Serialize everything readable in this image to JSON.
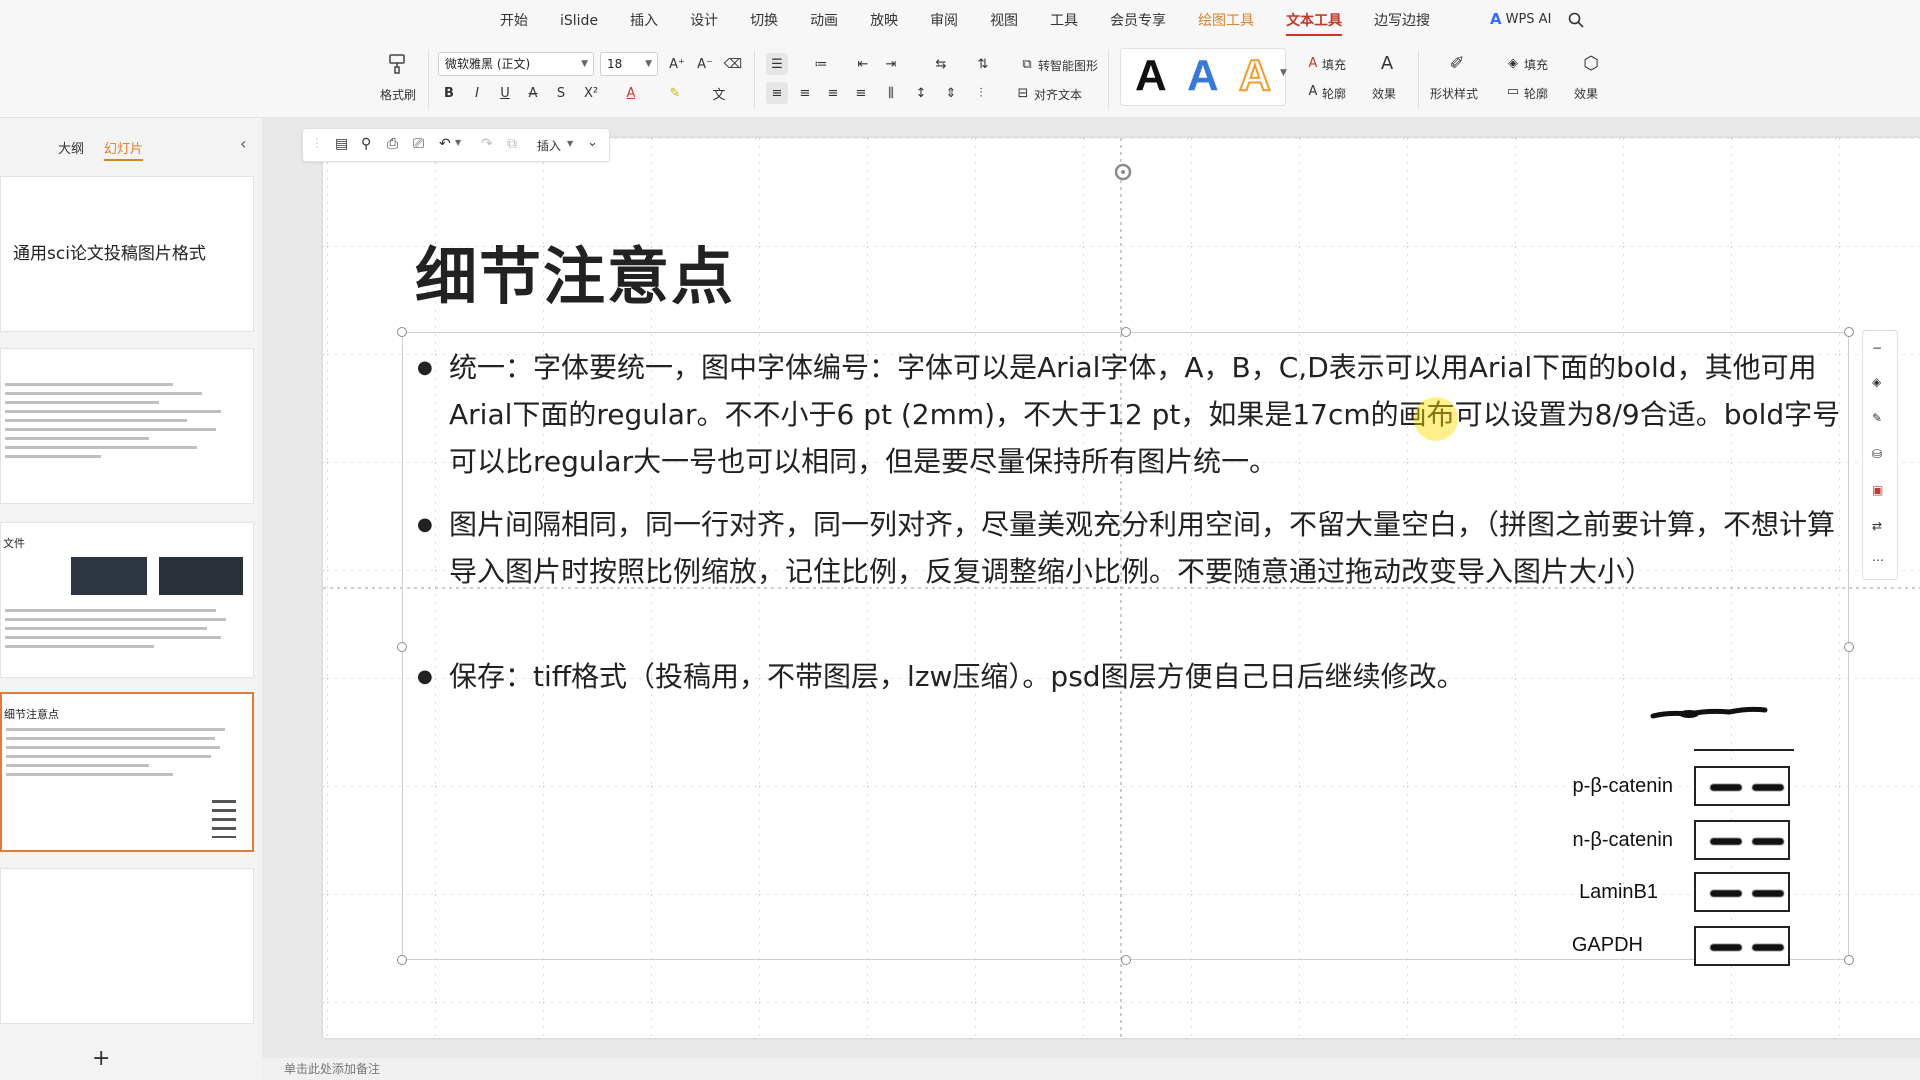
{
  "menu": {
    "items": [
      {
        "label": "开始",
        "state": "normal"
      },
      {
        "label": "iSlide",
        "state": "normal"
      },
      {
        "label": "插入",
        "state": "normal"
      },
      {
        "label": "设计",
        "state": "normal"
      },
      {
        "label": "切换",
        "state": "normal"
      },
      {
        "label": "动画",
        "state": "normal"
      },
      {
        "label": "放映",
        "state": "normal"
      },
      {
        "label": "审阅",
        "state": "normal"
      },
      {
        "label": "视图",
        "state": "normal"
      },
      {
        "label": "工具",
        "state": "normal"
      },
      {
        "label": "会员专享",
        "state": "normal"
      },
      {
        "label": "绘图工具",
        "state": "contextual"
      },
      {
        "label": "文本工具",
        "state": "active"
      },
      {
        "label": "边写边搜",
        "state": "normal"
      }
    ],
    "ai_label": "WPS AI"
  },
  "ribbon": {
    "format_painter": "格式刷",
    "font_name": "微软雅黑 (正文)",
    "font_size": "18",
    "smart_shape": "转智能图形",
    "align_text": "对齐文本",
    "fill": "填充",
    "outline": "轮廓",
    "effect": "效果",
    "shape_style": "形状样式",
    "fill2": "填充",
    "outline2": "轮廓",
    "effect2": "效果",
    "style_letter": "A",
    "colors": {
      "black": "#111111",
      "blue": "#3a78d8",
      "orange": "#f29a2e"
    }
  },
  "left_pane": {
    "tab_outline": "大纲",
    "tab_slides": "幻灯片",
    "thumb1_title": "通用sci论文投稿图片格式",
    "thumb3_title": "文件",
    "thumb4_title": "细节注意点"
  },
  "quickbar": {
    "insert_label": "插入"
  },
  "slide": {
    "title": "细节注意点",
    "bullets": [
      "统一：字体要统一，图中字体编号：字体可以是Arial字体，A，B，C,D表示可以用Arial下面的bold，其他可用Arial下面的regular。不不小于6 pt (2mm)，不大于12 pt，如果是17cm的画布可以设置为8/9合适。bold字号可以比regular大一号也可以相同，但是要尽量保持所有图片统一。",
      "图片间隔相同，同一行对齐，同一列对齐，尽量美观充分利用空间，不留大量空白，（拼图之前要计算，不想计算导入图片时按照比例缩放，记住比例，反复调整缩小比例。不要随意通过拖动改变导入图片大小）",
      "保存：tiff格式（投稿用，不带图层，lzw压缩）。psd图层方便自己日后继续修改。"
    ],
    "blot_labels": [
      "p-β-catenin",
      "n-β-catenin",
      "LaminB1",
      "GAPDH"
    ]
  },
  "status": {
    "notes_placeholder": "单击此处添加备注"
  }
}
